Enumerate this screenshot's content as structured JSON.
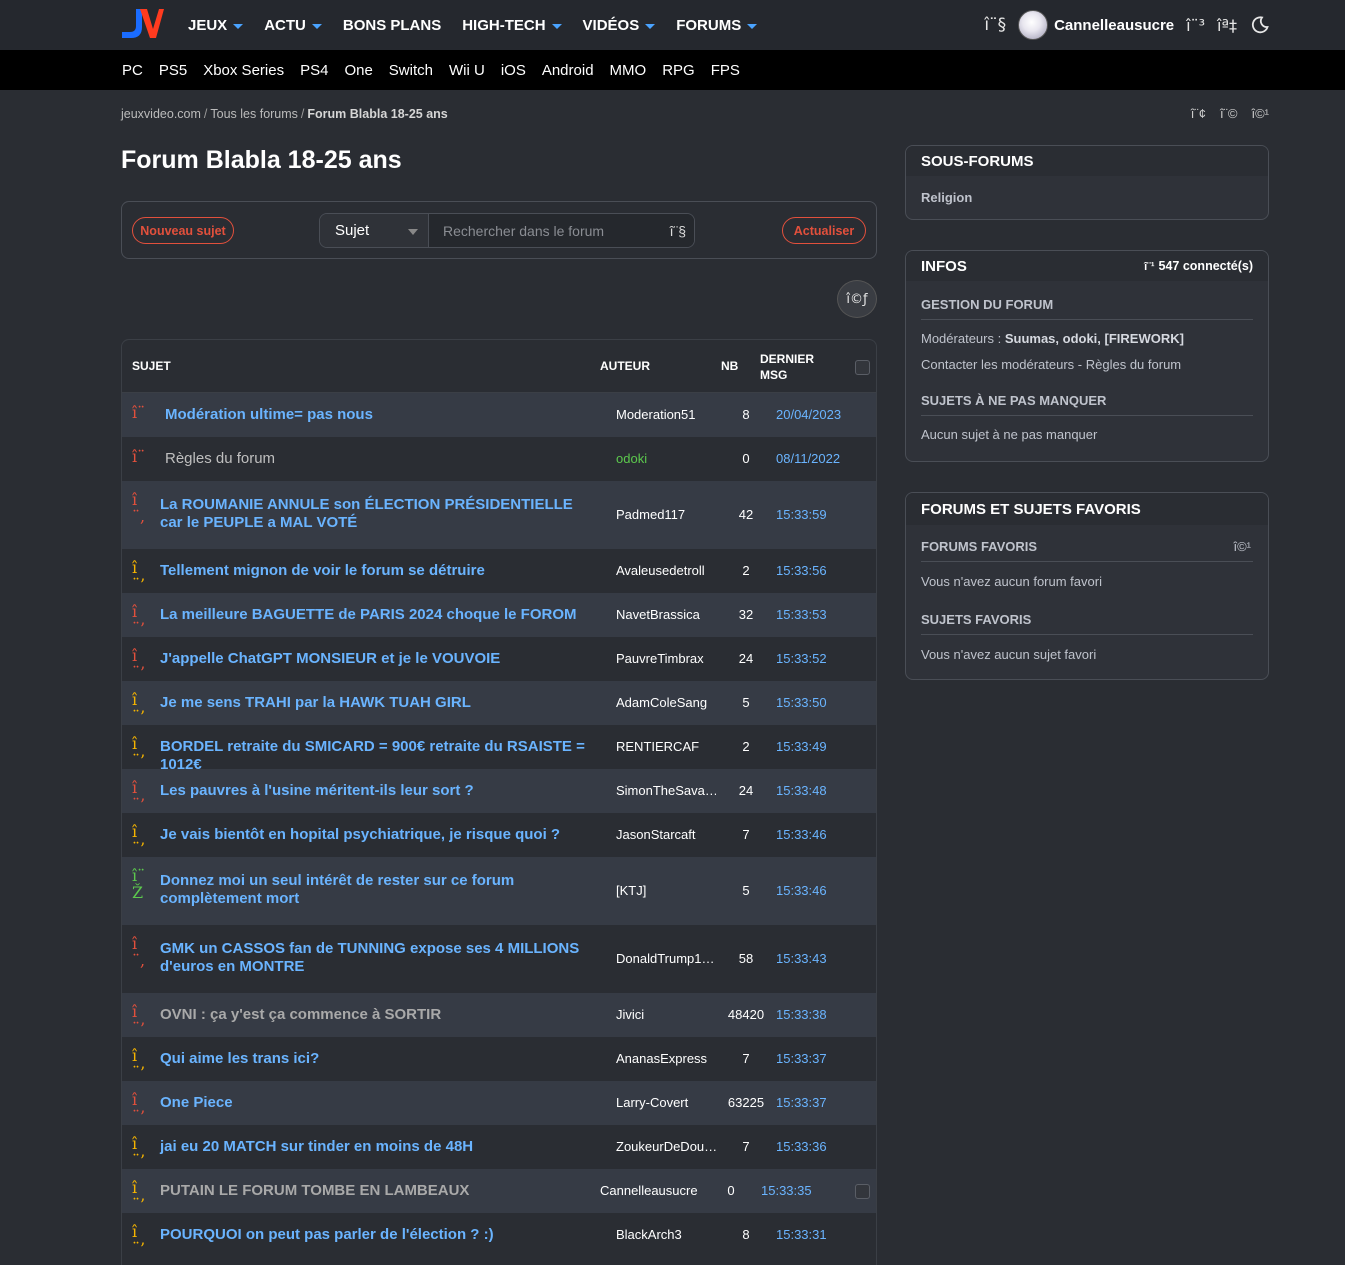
{
  "header": {
    "main_nav": [
      {
        "label": "JEUX",
        "dropdown": true
      },
      {
        "label": "ACTU",
        "dropdown": true
      },
      {
        "label": "BONS PLANS",
        "dropdown": false
      },
      {
        "label": "HIGH-TECH",
        "dropdown": true
      },
      {
        "label": "VIDÉOS",
        "dropdown": true
      },
      {
        "label": "FORUMS",
        "dropdown": true
      }
    ],
    "username": "Cannelleausucre",
    "icons": {
      "search": "î¨§",
      "messages": "î¨³",
      "notifications": "îª‡"
    }
  },
  "platform_nav": [
    "PC",
    "PS5",
    "Xbox Series",
    "PS4",
    "One",
    "Switch",
    "Wii U",
    "iOS",
    "Android",
    "MMO",
    "RPG",
    "FPS"
  ],
  "breadcrumb": {
    "home": "jeuxvideo.com",
    "forums": "Tous les forums",
    "current": "Forum Blabla 18-25 ans",
    "share_icons": [
      "î¨¢",
      "î¨©",
      "î©¹"
    ]
  },
  "page_title": "Forum Blabla 18-25 ans",
  "toolbar": {
    "new_topic": "Nouveau sujet",
    "search_type": "Sujet",
    "search_placeholder": "Rechercher dans le forum",
    "search_icon": "î¨§",
    "refresh": "Actualiser",
    "settings_icon": "î©ƒ"
  },
  "table": {
    "headers": {
      "subject": "SUJET",
      "author": "AUTEUR",
      "nb": "NB",
      "last": "DERNIER MSG"
    },
    "rows": [
      {
        "icon": "î¨",
        "icon_color": "#e2503c",
        "title": "Modération ultime= pas nous",
        "author": "Moderation51",
        "nb": "8",
        "date": "20/04/2023",
        "style": "link"
      },
      {
        "icon": "î¨",
        "icon_color": "#e2503c",
        "title": "Règles du forum",
        "author": "odoki",
        "nb": "0",
        "date": "08/11/2022",
        "style": "plain",
        "author_color": "green"
      },
      {
        "icon": "î¨,",
        "icon_color": "#e2503c",
        "title": "La ROUMANIE ANNULE son ÉLECTION PRÉSIDENTIELLE car le PEUPLE a MAL VOTÉ",
        "author": "Padmed117",
        "nb": "42",
        "date": "15:33:59",
        "style": "link"
      },
      {
        "icon": "î¨’",
        "icon_color": "#f5b400",
        "title": "Tellement mignon de voir le forum se détruire",
        "author": "Avaleusedetroll",
        "nb": "2",
        "date": "15:33:56",
        "style": "link"
      },
      {
        "icon": "î¨’",
        "icon_color": "#e2503c",
        "title": "La meilleure BAGUETTE de PARIS 2024 choque le FOROM",
        "author": "NavetBrassica",
        "nb": "32",
        "date": "15:33:53",
        "style": "link"
      },
      {
        "icon": "î¨’",
        "icon_color": "#e2503c",
        "title": "J'appelle ChatGPT MONSIEUR et je le VOUVOIE",
        "author": "PauvreTimbrax",
        "nb": "24",
        "date": "15:33:52",
        "style": "link"
      },
      {
        "icon": "î¨’",
        "icon_color": "#f5b400",
        "title": "Je me sens TRAHI par la HAWK TUAH GIRL",
        "author": "AdamColeSang",
        "nb": "5",
        "date": "15:33:50",
        "style": "link"
      },
      {
        "icon": "î¨’",
        "icon_color": "#f5b400",
        "title": "BORDEL retraite du SMICARD = 900€ retraite du RSAISTE = 1012€",
        "author": "RENTIERCAF",
        "nb": "2",
        "date": "15:33:49",
        "style": "link"
      },
      {
        "icon": "î¨’",
        "icon_color": "#e2503c",
        "title": "Les pauvres à l'usine méritent-ils leur sort ?",
        "author": "SimonTheSava…",
        "nb": "24",
        "date": "15:33:48",
        "style": "link"
      },
      {
        "icon": "î¨’",
        "icon_color": "#f5b400",
        "title": "Je vais bientôt en hopital psychiatrique, je risque quoi ?",
        "author": "JasonStarcaft",
        "nb": "7",
        "date": "15:33:46",
        "style": "link"
      },
      {
        "icon": "î¨Ž",
        "icon_color": "#5cc84d",
        "title": "Donnez moi un seul intérêt de rester sur ce forum complètement mort",
        "author": "[KTJ]",
        "nb": "5",
        "date": "15:33:46",
        "style": "link"
      },
      {
        "icon": "î¨,",
        "icon_color": "#e2503c",
        "title": "GMK un CASSOS fan de TUNNING expose ses 4 MILLIONS d'euros en MONTRE",
        "author": "DonaldTrump1…",
        "nb": "58",
        "date": "15:33:43",
        "style": "link"
      },
      {
        "icon": "î¨’",
        "icon_color": "#e2503c",
        "title": "OVNI : ça y'est ça commence à SORTIR",
        "author": "Jivici",
        "nb": "48420",
        "date": "15:33:38",
        "style": "grey"
      },
      {
        "icon": "î¨’",
        "icon_color": "#f5b400",
        "title": "Qui aime les trans ici?",
        "author": "AnanasExpress",
        "nb": "7",
        "date": "15:33:37",
        "style": "link"
      },
      {
        "icon": "î¨’",
        "icon_color": "#e2503c",
        "title": "One Piece",
        "author": "Larry-Covert",
        "nb": "63225",
        "date": "15:33:37",
        "style": "link"
      },
      {
        "icon": "î¨’",
        "icon_color": "#f5b400",
        "title": "jai eu 20 MATCH sur tinder en moins de 48H",
        "author": "ZoukeurDeDou…",
        "nb": "7",
        "date": "15:33:36",
        "style": "link"
      },
      {
        "icon": "î¨’",
        "icon_color": "#f5b400",
        "title": "PUTAIN LE FORUM TOMBE EN LAMBEAUX",
        "author": "Cannelleausucre",
        "nb": "0",
        "date": "15:33:35",
        "style": "grey",
        "own": true
      },
      {
        "icon": "î¨’",
        "icon_color": "#f5b400",
        "title": "POURQUOI on peut pas parler de l'élection ? :)",
        "author": "BlackArch3",
        "nb": "8",
        "date": "15:33:31",
        "style": "link"
      }
    ]
  },
  "sidebar": {
    "subforums": {
      "title": "SOUS-FORUMS",
      "items": [
        "Religion"
      ]
    },
    "infos": {
      "title": "INFOS",
      "connected_icon": "î¨¹",
      "connected": "547 connecté(s)",
      "management_title": "GESTION DU FORUM",
      "moderators_label": "Modérateurs :",
      "moderators": "Suumas, odoki, [FIREWORK]",
      "contact": "Contacter les modérateurs",
      "dash": " - ",
      "rules": "Règles du forum",
      "must_see_title": "SUJETS À NE PAS MANQUER",
      "must_see_text": "Aucun sujet à ne pas manquer"
    },
    "favorites": {
      "title": "FORUMS ET SUJETS FAVORIS",
      "forums_title": "FORUMS FAVORIS",
      "forums_icon": "î©¹",
      "forums_text": "Vous n'avez aucun forum favori",
      "topics_title": "SUJETS FAVORIS",
      "topics_text": "Vous n'avez aucun sujet favori"
    }
  }
}
